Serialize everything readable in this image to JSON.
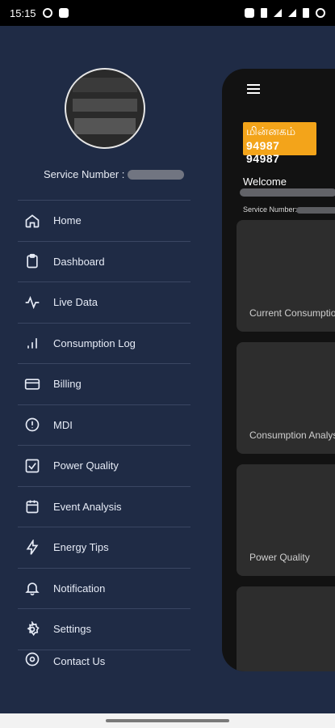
{
  "status_bar": {
    "time": "15:15"
  },
  "drawer": {
    "service_label": "Service Number :",
    "menu": [
      {
        "label": "Home",
        "icon": "home-icon"
      },
      {
        "label": "Dashboard",
        "icon": "clipboard-icon"
      },
      {
        "label": "Live Data",
        "icon": "pulse-icon"
      },
      {
        "label": "Consumption Log",
        "icon": "bar-chart-icon"
      },
      {
        "label": "Billing",
        "icon": "card-icon"
      },
      {
        "label": "MDI",
        "icon": "alert-circle-icon"
      },
      {
        "label": "Power Quality",
        "icon": "check-square-icon"
      },
      {
        "label": "Event Analysis",
        "icon": "calendar-icon"
      },
      {
        "label": "Energy Tips",
        "icon": "bolt-icon"
      },
      {
        "label": "Notification",
        "icon": "bell-icon"
      },
      {
        "label": "Settings",
        "icon": "gear-icon"
      },
      {
        "label": "Contact Us",
        "icon": "at-icon"
      }
    ]
  },
  "main": {
    "logo_line1": "மின்னகம்",
    "logo_line2": "94987 94987",
    "welcome": "Welcome",
    "service_small": "Service Number:",
    "cards": [
      {
        "label": "Current Consumption"
      },
      {
        "label": "Consumption Analysis"
      },
      {
        "label": "Power Quality"
      },
      {
        "label": ""
      }
    ]
  }
}
